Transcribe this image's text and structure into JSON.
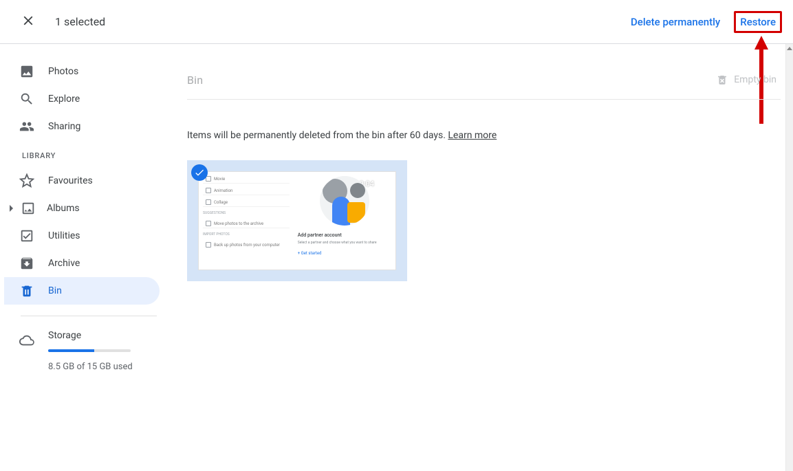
{
  "topbar": {
    "selected_label": "1 selected",
    "delete_label": "Delete permanently",
    "restore_label": "Restore"
  },
  "sidebar": {
    "items": {
      "photos": "Photos",
      "explore": "Explore",
      "sharing": "Sharing",
      "favourites": "Favourites",
      "albums": "Albums",
      "utilities": "Utilities",
      "archive": "Archive",
      "bin": "Bin"
    },
    "library_label": "LIBRARY",
    "storage": {
      "title": "Storage",
      "used_label": "8.5 GB of 15 GB used",
      "percent": 56
    }
  },
  "content": {
    "page_title": "Bin",
    "empty_bin": "Empty bin",
    "notice_text": "Items will be permanently deleted from the bin after 60 days. ",
    "learn_more": "Learn more"
  },
  "thumbnail": {
    "selected": true,
    "overlay_time": "0:04",
    "left_rows": [
      "Movie",
      "Animation",
      "Collage",
      "",
      "Move photos to the archive",
      "",
      "Back up photos from your computer"
    ],
    "right_title": "Add partner account",
    "right_sub": "Select a partner and choose what you want to share",
    "right_link": "+  Get started"
  }
}
